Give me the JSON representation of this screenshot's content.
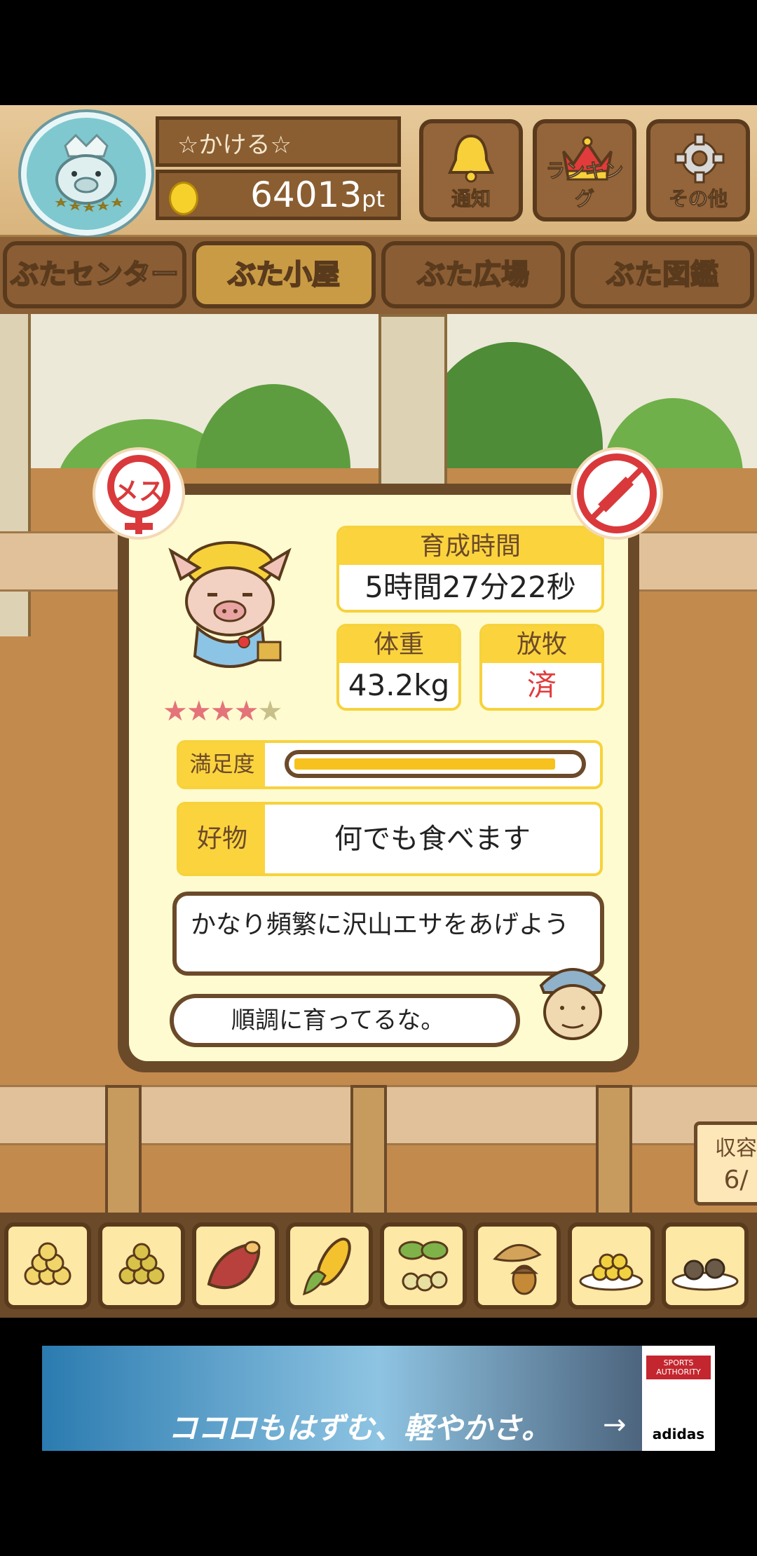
{
  "header": {
    "username": "☆かける☆",
    "points": "64013",
    "points_unit": "pt",
    "buttons": [
      {
        "label": "通知",
        "icon": "bell-icon"
      },
      {
        "label": "ランキング",
        "icon": "crown-icon"
      },
      {
        "label": "その他",
        "icon": "gear-icon"
      }
    ]
  },
  "tabs": [
    {
      "label": "ぶたセンター",
      "active": false
    },
    {
      "label": "ぶた小屋",
      "active": true
    },
    {
      "label": "ぶた広場",
      "active": false
    },
    {
      "label": "ぶた図鑑",
      "active": false
    }
  ],
  "pig_card": {
    "gender_badge": "メス",
    "rating_stars": 4,
    "rating_max": 5,
    "raising_time_label": "育成時間",
    "raising_time_value": "5時間27分22秒",
    "weight_label": "体重",
    "weight_value": "43.2kg",
    "grazing_label": "放牧",
    "grazing_value": "済",
    "satisfaction_label": "満足度",
    "satisfaction_fraction": 0.95,
    "favorite_label": "好物",
    "favorite_value": "何でも食べます",
    "advice_text": "かなり頻繁に沢山エサをあげよう",
    "comment_text": "順調に育ってるな。"
  },
  "capacity": {
    "label": "収容",
    "value": "6/"
  },
  "food_items": [
    "soybeans-icon",
    "beans-icon",
    "sweet-potato-icon",
    "corn-icon",
    "plant-icon",
    "acorn-icon",
    "beans-plate-icon",
    "dumplings-plate-icon"
  ],
  "ad": {
    "headline": "ココロもはずむ、軽やかさ。",
    "brand_top": "SPORTS AUTHORITY",
    "brand_bottom": "adidas"
  },
  "colors": {
    "accent_yellow": "#fbd33d",
    "wood_dark": "#6b4a2a",
    "gender_red": "#d9393b",
    "grazing_red": "#e23b3b"
  }
}
